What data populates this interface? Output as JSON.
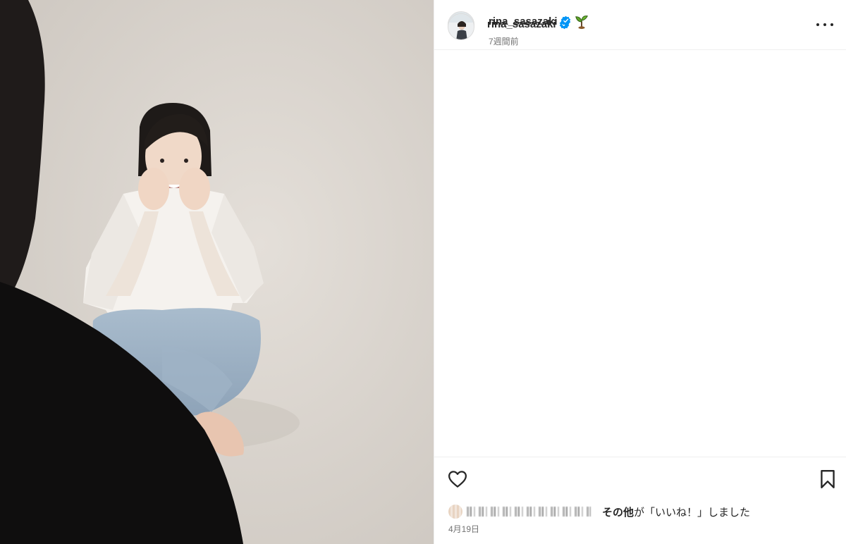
{
  "post": {
    "username": "rina_sasazaki",
    "verified": true,
    "time_ago": "7週間前",
    "date": "4月19日"
  },
  "header": {
    "username": "rina_sasazaki",
    "more_icon": "more-horizontal-icon"
  },
  "caption": {
    "emoji": "seedling-emoji",
    "text": ""
  },
  "likes": {
    "others_label": "その他",
    "suffix": "が「いいね！」しました"
  },
  "icons": {
    "like": "heart-outline-icon",
    "save": "bookmark-outline-icon",
    "verified": "verified-badge-icon"
  },
  "colors": {
    "verified_blue": "#0095f6",
    "text_primary": "#262626",
    "text_secondary": "#737373",
    "divider": "#efefef"
  }
}
